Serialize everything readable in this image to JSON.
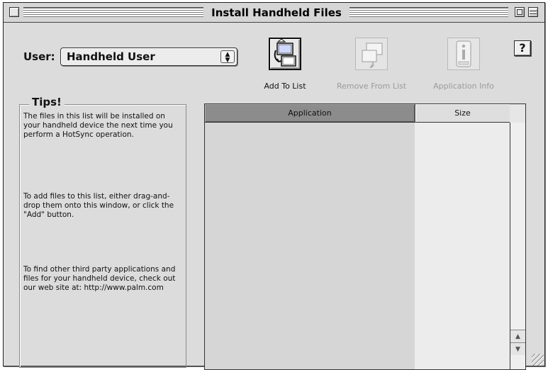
{
  "window": {
    "title": "Install Handheld Files"
  },
  "user": {
    "label": "User:",
    "selected": "Handheld User"
  },
  "help": {
    "label": "?"
  },
  "toolbar": {
    "add_label": "Add To List",
    "remove_label": "Remove From List",
    "info_label": "Application Info"
  },
  "tips": {
    "title": "Tips!",
    "p1": "The files in this list will be installed on your handheld device the next time you perform a HotSync operation.",
    "p2": "To add files to this list, either drag-and-drop them onto this window, or click the \"Add\" button.",
    "p3": "To find other third party applications and files for your handheld device, check out our web site at: http://www.palm.com"
  },
  "list": {
    "columns": [
      "Application",
      "Size"
    ],
    "rows": []
  },
  "icons": {
    "add": "add-to-list-icon",
    "remove": "remove-from-list-icon",
    "info": "application-info-icon"
  }
}
